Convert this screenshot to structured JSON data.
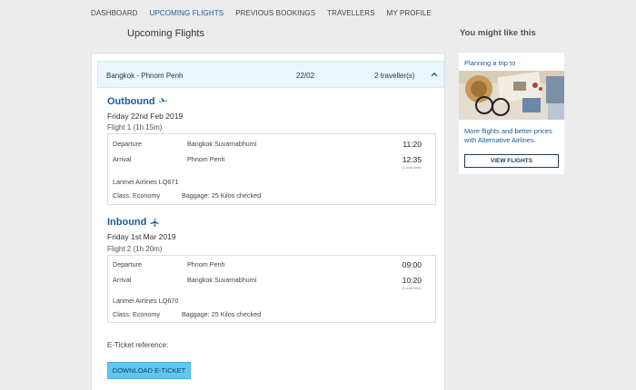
{
  "nav": [
    {
      "label": "DASHBOARD"
    },
    {
      "label": "UPCOMING FLIGHTS",
      "active": true
    },
    {
      "label": "PREVIOUS BOOKINGS"
    },
    {
      "label": "TRAVELLERS"
    },
    {
      "label": "MY PROFILE"
    }
  ],
  "page_title": "Upcoming Flights",
  "aside_title": "You might like this",
  "trip": {
    "route": "Bangkok - Phnom Penh",
    "date": "22/02",
    "travellers": "2 traveller(s)"
  },
  "outbound": {
    "title": "Outbound",
    "date": "Friday 22nd Feb 2019",
    "flight": "Flight 1 (1h 15m)",
    "departure_label": "Departure",
    "departure_place": "Bangkok Suvarnabhumi",
    "departure_time": "11:20",
    "arrival_label": "Arrival",
    "arrival_place": "Phnom Penh",
    "arrival_time": "12:35",
    "local_time": "(Local time)",
    "airline": "Lanmei Airlines LQ671",
    "class": "Class: Economy",
    "baggage": "Baggage: 25 Kilos checked"
  },
  "inbound": {
    "title": "Inbound",
    "date": "Friday 1st Mar 2019",
    "flight": "Flight 2 (1h 20m)",
    "departure_label": "Departure",
    "departure_place": "Phnom Penh",
    "departure_time": "09:00",
    "arrival_label": "Arrival",
    "arrival_place": "Bangkok Suvarnabhumi",
    "arrival_time": "10:20",
    "local_time": "(Local time)",
    "airline": "Lanmei Airlines LQ670",
    "class": "Class: Economy",
    "baggage": "Baggage: 25 Kilos checked"
  },
  "eticket_label": "E-Ticket reference:",
  "download_button": "DOWNLOAD E-TICKET",
  "promo": {
    "title": "Planning a trip to",
    "text": "More flights and better prices with Alternative Airlines.",
    "button": "VIEW FLIGHTS"
  },
  "colors": {
    "accent": "#1a5a9e",
    "button": "#5bc8f2",
    "header_bg": "#e9f6fd",
    "page_bg": "#ececec"
  }
}
